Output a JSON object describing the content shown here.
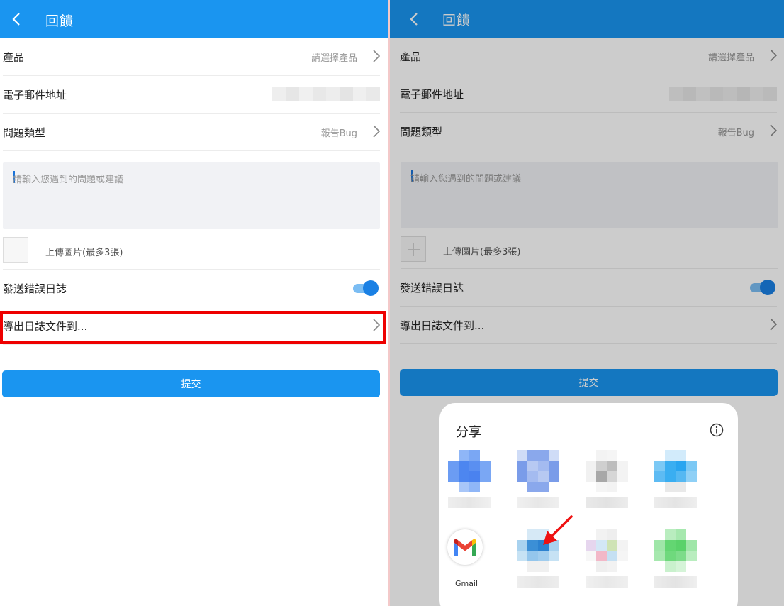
{
  "left_panel": {
    "header": {
      "title": "回饋"
    },
    "product": {
      "label": "產品",
      "value": "請選擇產品"
    },
    "email": {
      "label": "電子郵件地址"
    },
    "issue_type": {
      "label": "問題類型",
      "value": "報告Bug"
    },
    "feedback": {
      "placeholder": "請輸入您遇到的問題或建議"
    },
    "upload": {
      "label": "上傳圖片(最多3張)"
    },
    "send_log": {
      "label": "發送錯誤日誌",
      "enabled": true
    },
    "export_log": {
      "label": "導出日誌文件到..."
    },
    "submit": {
      "label": "提交"
    }
  },
  "right_panel": {
    "header": {
      "title": "回饋"
    },
    "product": {
      "label": "產品",
      "value": "請選擇產品"
    },
    "email": {
      "label": "電子郵件地址"
    },
    "issue_type": {
      "label": "問題類型",
      "value": "報告Bug"
    },
    "feedback": {
      "placeholder": "請輸入您遇到的問題或建議"
    },
    "upload": {
      "label": "上傳圖片(最多3張)"
    },
    "send_log": {
      "label": "發送錯誤日誌",
      "enabled": true
    },
    "export_log": {
      "label": "導出日誌文件到..."
    },
    "submit": {
      "label": "提交"
    },
    "share_sheet": {
      "title": "分享",
      "info_icon": "info-icon",
      "apps": [
        {
          "name": "",
          "blurred": true
        },
        {
          "name": "",
          "blurred": true
        },
        {
          "name": "",
          "blurred": true
        },
        {
          "name": "",
          "blurred": true
        },
        {
          "name": "Gmail",
          "blurred": false,
          "icon": "gmail-icon"
        },
        {
          "name": "",
          "blurred": true
        },
        {
          "name": "",
          "blurred": true
        },
        {
          "name": "",
          "blurred": true
        }
      ]
    }
  },
  "colors": {
    "header": "#1a95f0",
    "submit": "#1a95f0",
    "highlight": "#ee0000",
    "arrow": "#ee1111",
    "toggle_on": "#1a80e4"
  }
}
